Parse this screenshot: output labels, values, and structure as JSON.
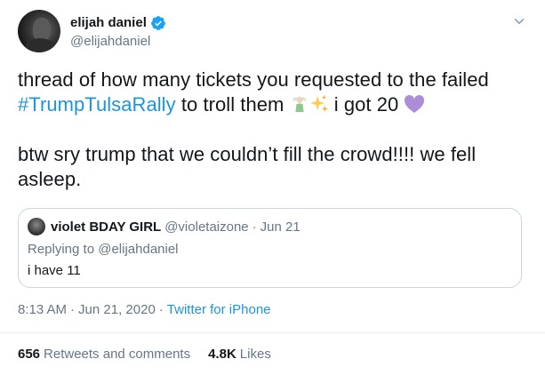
{
  "author": {
    "display_name": "elijah daniel",
    "handle": "@elijahdaniel",
    "verified": true
  },
  "tweet": {
    "text_before_hashtag": "thread of how many tickets you requested to the failed",
    "hashtag": "#TrumpTulsaRally",
    "text_after_hashtag": " to troll them",
    "text_after_emoji": " i got 20 ",
    "paragraph2": "btw sry trump that we couldn’t fill the crowd!!!! we fell asleep."
  },
  "quoted_tweet": {
    "display_name": "violet BDAY GIRL",
    "handle": "@violetaizone",
    "separator": "·",
    "date": "Jun 21",
    "replying_to_label": "Replying to",
    "replying_to_handle": "@elijahdaniel",
    "text": "i have 11"
  },
  "meta": {
    "time": "8:13 AM",
    "separator": "·",
    "date": "Jun 21, 2020",
    "source": "Twitter for iPhone"
  },
  "stats": {
    "retweets_count": "656",
    "retweets_label": "Retweets and comments",
    "likes_count": "4.8K",
    "likes_label": "Likes"
  },
  "icons": [
    "verified-badge-icon",
    "chevron-down-icon",
    "fairy-emoji-icon",
    "sparkles-emoji-icon",
    "purple-heart-emoji-icon"
  ],
  "colors": {
    "link": "#1b95e0",
    "secondary_text": "#657786",
    "verified": "#1da1f2",
    "heart": "#aa8ed6"
  }
}
